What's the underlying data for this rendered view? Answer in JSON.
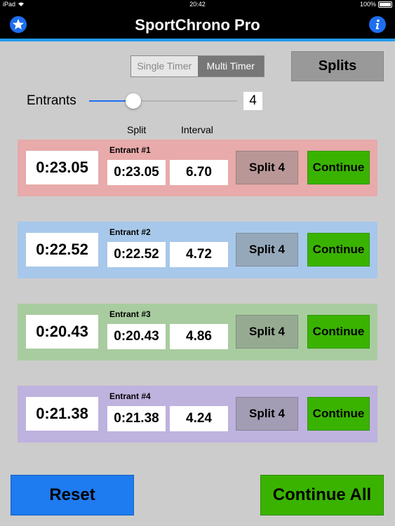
{
  "status_bar": {
    "device": "iPad",
    "time": "20:42",
    "battery": "100%"
  },
  "nav": {
    "title": "SportChrono Pro",
    "left_icon": "star-icon",
    "right_icon": "info-icon"
  },
  "mode": {
    "options": [
      "Single Timer",
      "Multi Timer"
    ],
    "selected": "Multi Timer"
  },
  "splits_label": "Splits",
  "entrants": {
    "label": "Entrants",
    "value": "4",
    "slider_fraction": 0.3
  },
  "columns": {
    "split": "Split",
    "interval": "Interval"
  },
  "rows": [
    {
      "label": "Entrant #1",
      "time": "0:23.05",
      "split": "0:23.05",
      "interval": "6.70",
      "split_button": "Split 4",
      "continue": "Continue",
      "color": "#e8aaaa"
    },
    {
      "label": "Entrant #2",
      "time": "0:22.52",
      "split": "0:22.52",
      "interval": "4.72",
      "split_button": "Split 4",
      "continue": "Continue",
      "color": "#a7c8ea"
    },
    {
      "label": "Entrant #3",
      "time": "0:20.43",
      "split": "0:20.43",
      "interval": "4.86",
      "split_button": "Split 4",
      "continue": "Continue",
      "color": "#a8cca0"
    },
    {
      "label": "Entrant #4",
      "time": "0:21.38",
      "split": "0:21.38",
      "interval": "4.24",
      "split_button": "Split 4",
      "continue": "Continue",
      "color": "#beb2de"
    }
  ],
  "reset_label": "Reset",
  "continue_all_label": "Continue All",
  "colors": {
    "accent": "#1e6ef0",
    "continue": "#3ab300",
    "reset": "#1e7bf0"
  }
}
